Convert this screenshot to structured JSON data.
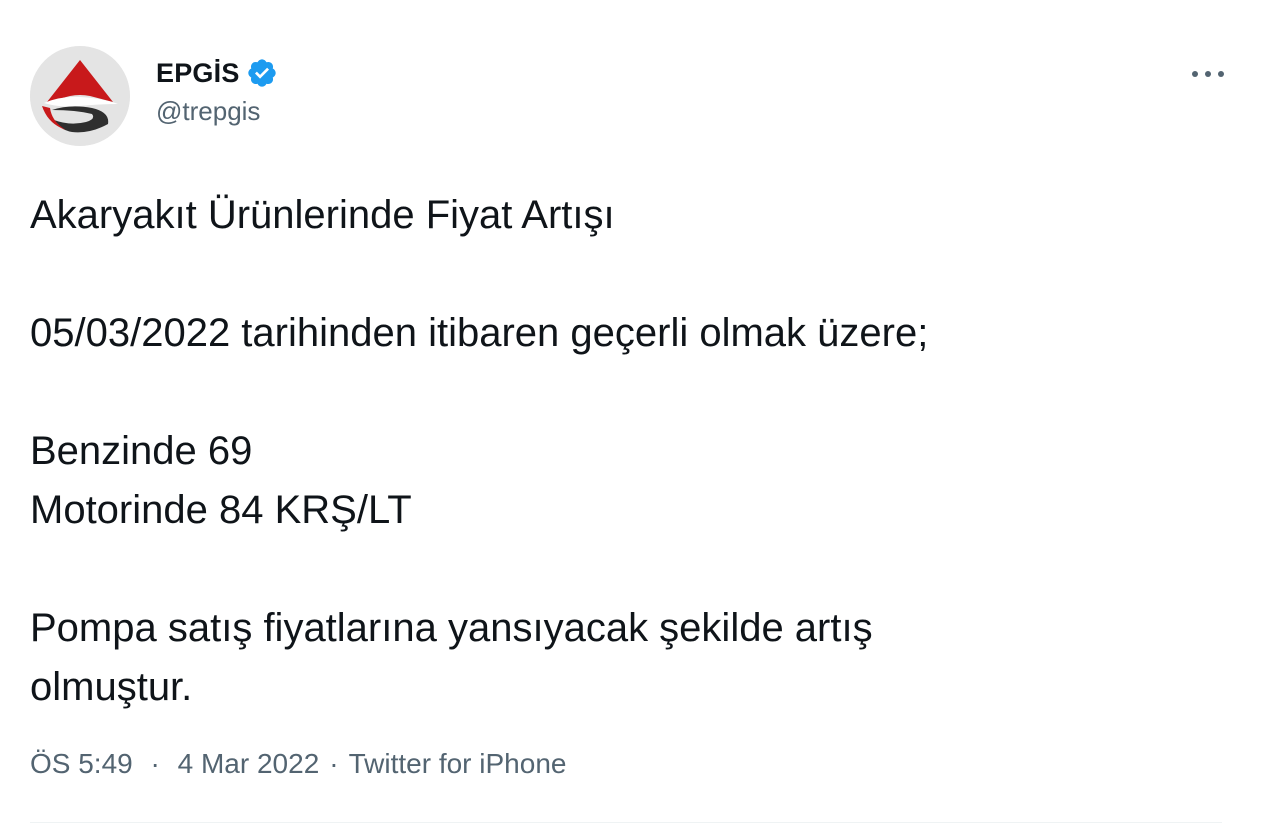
{
  "author": {
    "display_name": "EPGİS",
    "handle": "@trepgis",
    "verified": true,
    "verified_icon": "verified-badge-icon"
  },
  "tweet": {
    "lines": [
      "Akaryakıt Ürünlerinde Fiyat Artışı",
      "",
      "05/03/2022 tarihinden itibaren geçerli olmak üzere;",
      "",
      "Benzinde 69",
      "Motorinde 84 KRŞ/LT",
      "",
      "Pompa satış fiyatlarına yansıyacak şekilde artış",
      "olmuştur."
    ]
  },
  "meta": {
    "time": "ÖS 5:49",
    "date": "4 Mar 2022",
    "source": "Twitter for iPhone",
    "separator": "·"
  },
  "icons": {
    "more": "more-options-icon"
  },
  "colors": {
    "verified_blue": "#1d9bf0",
    "text": "#0f1419",
    "secondary_text": "#536471",
    "logo_red": "#c8191b",
    "logo_dark": "#333333"
  }
}
